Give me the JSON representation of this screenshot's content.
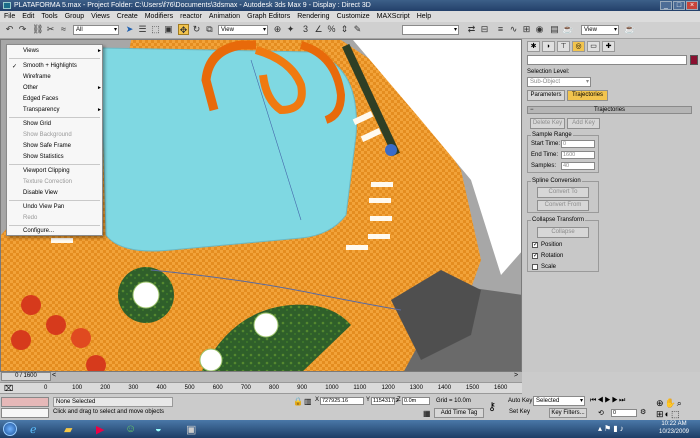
{
  "window": {
    "title": "PLATAFORMA 5.max    - Project Folder: C:\\Users\\f76\\Documents\\3dsmax    - Autodesk 3ds Max 9    - Display : Direct 3D"
  },
  "menu": [
    "File",
    "Edit",
    "Tools",
    "Group",
    "Views",
    "Create",
    "Modifiers",
    "reactor",
    "Animation",
    "Graph Editors",
    "Rendering",
    "Customize",
    "MAXScript",
    "Help"
  ],
  "toolbar": {
    "selection_filter": "All",
    "ref_coord": "View",
    "named_set": "",
    "view_dropdown": "View"
  },
  "context_menu": {
    "items": [
      {
        "label": "Views",
        "submenu": true
      },
      {
        "label": "Smooth + Highlights",
        "checked": true
      },
      {
        "label": "Wireframe"
      },
      {
        "label": "Other",
        "submenu": true
      },
      {
        "label": "Edged Faces"
      },
      {
        "label": "Transparency",
        "submenu": true
      },
      {
        "label": "Show Grid"
      },
      {
        "label": "Show Background",
        "disabled": true
      },
      {
        "label": "Show Safe Frame"
      },
      {
        "label": "Show Statistics"
      },
      {
        "label": "Viewport Clipping"
      },
      {
        "label": "Texture Correction",
        "disabled": true
      },
      {
        "label": "Disable View"
      },
      {
        "label": "Undo View Pan"
      },
      {
        "label": "Redo",
        "disabled": true
      },
      {
        "label": "Configure..."
      }
    ]
  },
  "panel": {
    "selection_level": "Selection Level:",
    "sub_object": "Sub-Object",
    "tab_parameters": "Parameters",
    "tab_trajectories": "Trajectories",
    "rollout": "Trajectories",
    "delete_key": "Delete Key",
    "add_key": "Add Key",
    "sample_range": "Sample Range",
    "start_time_label": "Start Time:",
    "start_time": "0",
    "end_time_label": "End Time:",
    "end_time": "1600",
    "samples_label": "Samples:",
    "samples": "40",
    "spline_conversion": "Spline Conversion",
    "convert_to": "Convert To",
    "convert_from": "Convert From",
    "collapse_transform": "Collapse Transform",
    "collapse": "Collapse",
    "position": "Position",
    "rotation": "Rotation",
    "scale": "Scale",
    "position_checked": true,
    "rotation_checked": true,
    "scale_checked": false
  },
  "timeline": {
    "slider": "0 / 1600",
    "ticks": [
      "0",
      "100",
      "200",
      "300",
      "400",
      "500",
      "600",
      "700",
      "800",
      "900",
      "1000",
      "1100",
      "1200",
      "1300",
      "1400",
      "1500",
      "1600"
    ]
  },
  "status": {
    "selection": "None Selected",
    "prompt": "Click and drag to select and move objects",
    "x_label": "X",
    "x": "727925.16",
    "y_label": "Y",
    "y": "1154317.2",
    "z_label": "Z",
    "z": "0.0m",
    "grid": "Grid = 10.0m",
    "add_time_tag": "Add Time Tag",
    "auto_key": "Auto Key",
    "set_key": "Set Key",
    "selected": "Selected",
    "key_filters": "Key Filters...",
    "frame": "0"
  },
  "taskbar": {
    "clock_time": "10:22 AM",
    "clock_date": "10/23/2009"
  },
  "colors": {
    "title": "#2d4e78",
    "water": "#7fd8e2",
    "paving": "#f2a33a",
    "trajectories_active": "#f2c44e"
  }
}
